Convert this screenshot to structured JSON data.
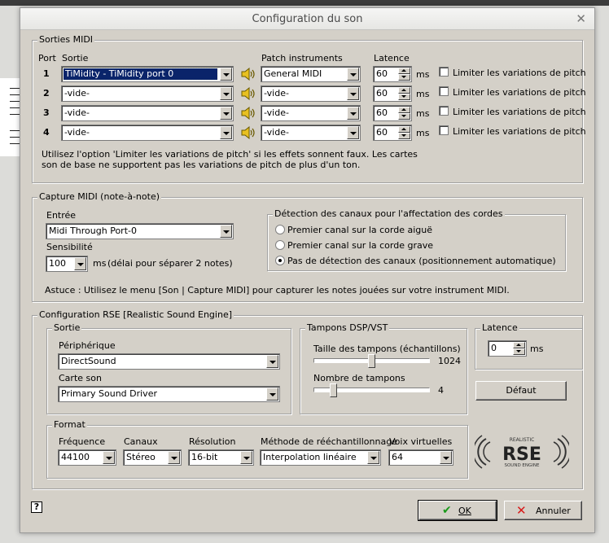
{
  "dialog": {
    "title": "Configuration du son"
  },
  "midi": {
    "legend": "Sorties MIDI",
    "col_port": "Port",
    "col_sortie": "Sortie",
    "col_patch": "Patch instruments",
    "col_latence": "Latence",
    "rows": [
      {
        "port": "1",
        "sortie": "TiMidity - TiMidity port 0",
        "patch": "General MIDI",
        "latence": "60",
        "unit": "ms",
        "limit": "Limiter les variations de pitch"
      },
      {
        "port": "2",
        "sortie": "-vide-",
        "patch": "-vide-",
        "latence": "60",
        "unit": "ms",
        "limit": "Limiter les variations de pitch"
      },
      {
        "port": "3",
        "sortie": "-vide-",
        "patch": "-vide-",
        "latence": "60",
        "unit": "ms",
        "limit": "Limiter les variations de pitch"
      },
      {
        "port": "4",
        "sortie": "-vide-",
        "patch": "-vide-",
        "latence": "60",
        "unit": "ms",
        "limit": "Limiter les variations de pitch"
      }
    ],
    "note1": "Utilisez l'option 'Limiter les variations de pitch' si les effets sonnent faux. Les cartes",
    "note2": "son de base ne supportent pas les variations de pitch de plus d'un ton."
  },
  "capture": {
    "legend": "Capture MIDI (note-à-note)",
    "entree_label": "Entrée",
    "entree": "Midi Through Port-0",
    "sens_label": "Sensibilité",
    "sens": "100",
    "sens_unit": "ms",
    "sens_hint": "(délai pour séparer 2 notes)",
    "det_legend": "Détection des canaux pour l'affectation des cordes",
    "radio1": "Premier canal sur la corde aiguë",
    "radio2": "Premier canal sur la corde grave",
    "radio3": "Pas de détection des canaux (positionnement automatique)",
    "tip": "Astuce : Utilisez le menu [Son | Capture MIDI] pour capturer les notes jouées sur votre instrument MIDI."
  },
  "rse": {
    "legend": "Configuration RSE [Realistic Sound Engine]",
    "sortie_legend": "Sortie",
    "periph_label": "Périphérique",
    "periph": "DirectSound",
    "carte_label": "Carte son",
    "carte": "Primary Sound Driver",
    "dsp_legend": "Tampons DSP/VST",
    "taille_label": "Taille des tampons (échantillons)",
    "taille_value": "1024",
    "taille_frac": 0.5,
    "nombre_label": "Nombre de tampons",
    "nombre_value": "4",
    "nombre_frac": 0.15,
    "lat_legend": "Latence",
    "lat_value": "0",
    "lat_unit": "ms",
    "defaut": "Défaut",
    "format_legend": "Format",
    "freq_label": "Fréquence",
    "freq": "44100",
    "canaux_label": "Canaux",
    "canaux": "Stéreo",
    "res_label": "Résolution",
    "res": "16-bit",
    "method_label": "Méthode de rééchantillonnage",
    "method": "Interpolation linéaire",
    "voix_label": "Voix virtuelles",
    "voix": "64",
    "logo_top": "REALISTIC",
    "logo_mid": "RSE",
    "logo_bot": "SOUND ENGINE"
  },
  "footer": {
    "help": "?",
    "ok": "OK",
    "annuler": "Annuler"
  }
}
